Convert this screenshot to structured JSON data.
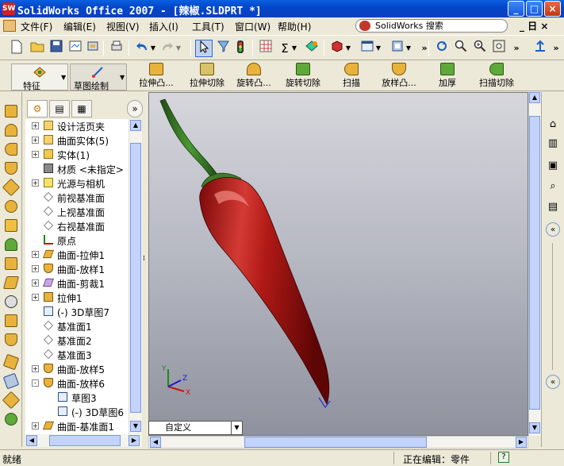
{
  "window": {
    "title": "SolidWorks Office 2007 - [辣椒.SLDPRT *]",
    "app_icon_text": "SW",
    "controls": {
      "minimize": "_",
      "maximize": "□",
      "close": "×"
    }
  },
  "menubar": {
    "items": [
      "文件(F)",
      "编辑(E)",
      "视图(V)",
      "插入(I)",
      "工具(T)",
      "窗口(W)",
      "帮助(H)"
    ],
    "search_placeholder": "SolidWorks 搜索",
    "restore": "_ 日 ×"
  },
  "feature_toolbar": {
    "big_buttons": [
      "特征",
      "草图绘制"
    ],
    "buttons": [
      "拉伸凸...",
      "拉伸切除",
      "旋转凸...",
      "旋转切除",
      "扫描",
      "放样凸...",
      "加厚",
      "扫描切除"
    ]
  },
  "feature_tree": {
    "nodes": [
      {
        "label": "设计活页夹",
        "expand": "+",
        "icon": "binder-icon"
      },
      {
        "label": "曲面实体(5)",
        "expand": "+",
        "icon": "surface-bodies-icon"
      },
      {
        "label": "实体(1)",
        "expand": "+",
        "icon": "solid-bodies-icon"
      },
      {
        "label": "材质 <未指定>",
        "expand": "",
        "icon": "material-icon"
      },
      {
        "label": "光源与相机",
        "expand": "+",
        "icon": "lights-icon"
      },
      {
        "label": "前视基准面",
        "expand": "",
        "icon": "plane-icon"
      },
      {
        "label": "上视基准面",
        "expand": "",
        "icon": "plane-icon"
      },
      {
        "label": "右视基准面",
        "expand": "",
        "icon": "plane-icon"
      },
      {
        "label": "原点",
        "expand": "",
        "icon": "origin-icon"
      },
      {
        "label": "曲面-拉伸1",
        "expand": "+",
        "icon": "surface-extrude-icon"
      },
      {
        "label": "曲面-放样1",
        "expand": "+",
        "icon": "surface-loft-icon"
      },
      {
        "label": "曲面-剪裁1",
        "expand": "+",
        "icon": "surface-trim-icon"
      },
      {
        "label": "拉伸1",
        "expand": "+",
        "icon": "extrude-icon"
      },
      {
        "label": "(-) 3D草图7",
        "expand": "",
        "icon": "sketch3d-icon"
      },
      {
        "label": "基准面1",
        "expand": "",
        "icon": "plane-icon"
      },
      {
        "label": "基准面2",
        "expand": "",
        "icon": "plane-icon"
      },
      {
        "label": "基准面3",
        "expand": "",
        "icon": "plane-icon"
      },
      {
        "label": "曲面-放样5",
        "expand": "+",
        "icon": "surface-loft-icon"
      },
      {
        "label": "曲面-放样6",
        "expand": "-",
        "icon": "surface-loft-icon"
      },
      {
        "label": "草图3",
        "expand": "",
        "icon": "sketch-icon",
        "indent": true
      },
      {
        "label": "(-) 3D草图6",
        "expand": "",
        "icon": "sketch3d-icon",
        "indent": true
      },
      {
        "label": "曲面-基准面1",
        "expand": "+",
        "icon": "surface-plane-icon"
      }
    ]
  },
  "viewport": {
    "configuration": "自定义",
    "triad": {
      "x": "X",
      "y": "Y",
      "z": "Z"
    }
  },
  "colors": {
    "pepper_red": "#B11A16",
    "stem_green": "#2E6B1E",
    "titlebar_blue": "#0347C9"
  },
  "statusbar": {
    "left": "就绪",
    "right": "正在编辑：零件",
    "help": "?"
  }
}
